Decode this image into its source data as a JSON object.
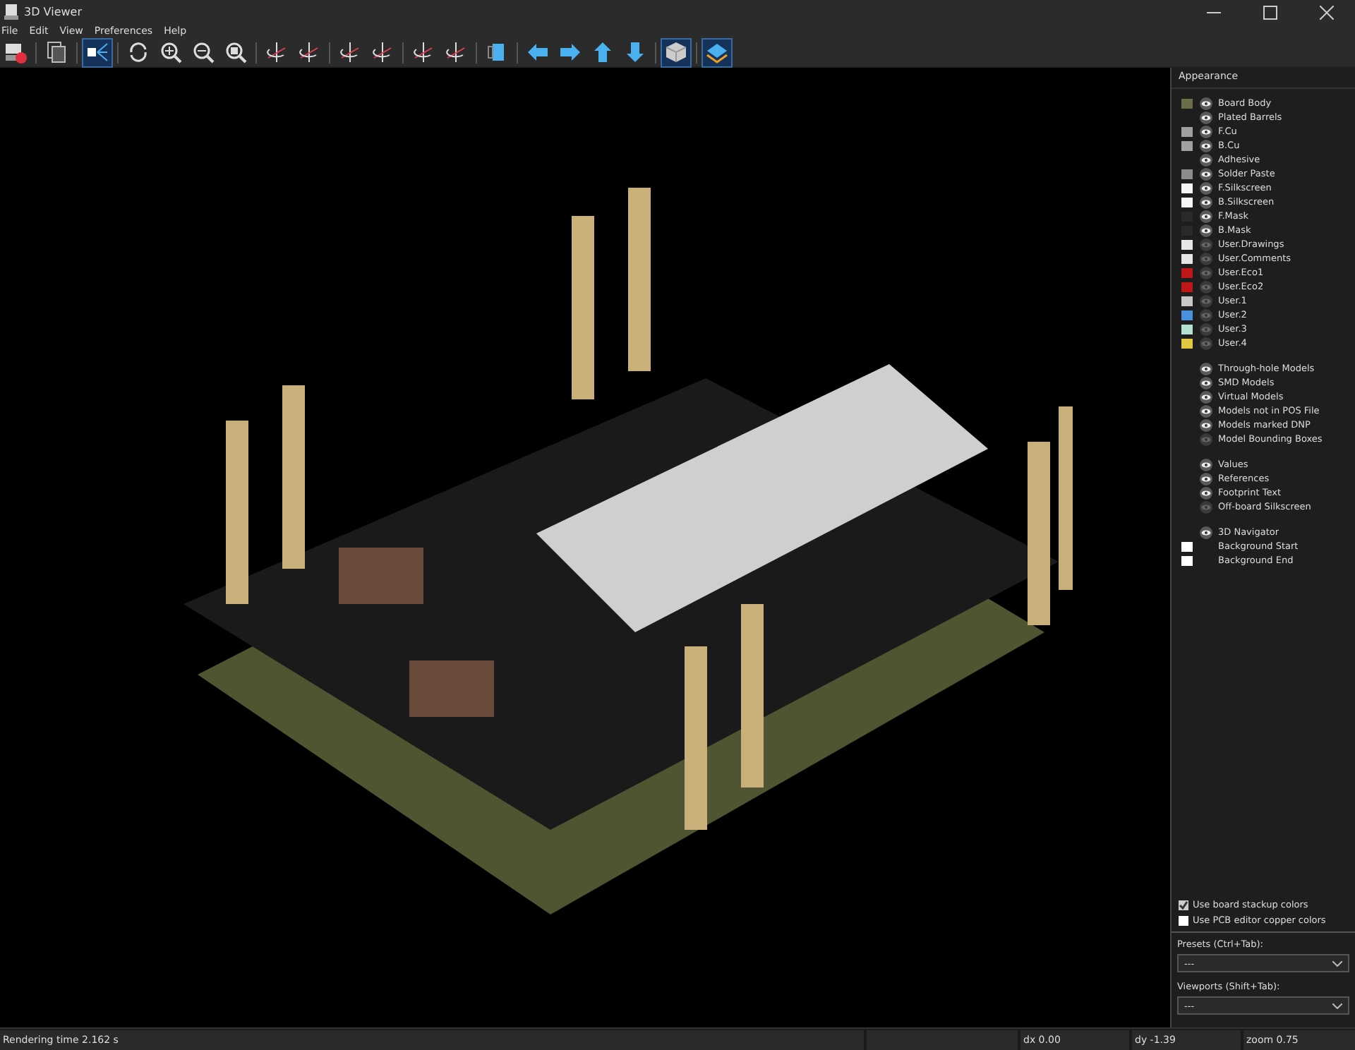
{
  "window": {
    "title": "3D Viewer"
  },
  "menu": [
    "File",
    "Edit",
    "View",
    "Preferences",
    "Help"
  ],
  "toolbar": [
    [
      {
        "kind": "export",
        "on": false
      }
    ],
    [
      {
        "kind": "copy",
        "on": false
      }
    ],
    [
      {
        "kind": "raytrace",
        "on": true
      }
    ],
    [
      {
        "kind": "refresh",
        "on": false
      },
      {
        "kind": "zoom-in",
        "on": false
      },
      {
        "kind": "zoom-out",
        "on": false
      },
      {
        "kind": "zoom-fit",
        "on": false
      }
    ],
    [
      {
        "kind": "rotate",
        "on": false
      },
      {
        "kind": "rotate",
        "on": false
      }
    ],
    [
      {
        "kind": "rotate",
        "on": false
      },
      {
        "kind": "rotate",
        "on": false
      }
    ],
    [
      {
        "kind": "rotate",
        "on": false
      },
      {
        "kind": "rotate",
        "on": false
      }
    ],
    [
      {
        "kind": "flip",
        "on": false
      }
    ],
    [
      {
        "kind": "arrow-left",
        "on": false
      },
      {
        "kind": "arrow-right",
        "on": false
      },
      {
        "kind": "arrow-up",
        "on": false
      },
      {
        "kind": "arrow-down",
        "on": false
      }
    ],
    [
      {
        "kind": "cube",
        "on": true
      }
    ],
    [
      {
        "kind": "layers",
        "on": true
      }
    ]
  ],
  "appearance": {
    "title": "Appearance",
    "groups": [
      [
        {
          "label": "Board Body",
          "color": "#6b6e48",
          "visible": true
        },
        {
          "label": "Plated Barrels",
          "visible": true
        },
        {
          "label": "F.Cu",
          "color": "#a0a0a0",
          "visible": true
        },
        {
          "label": "B.Cu",
          "color": "#a0a0a0",
          "visible": true
        },
        {
          "label": "Adhesive",
          "visible": true
        },
        {
          "label": "Solder Paste",
          "color": "#8c8c8c",
          "visible": true
        },
        {
          "label": "F.Silkscreen",
          "color": "#f5f5f5",
          "visible": true
        },
        {
          "label": "B.Silkscreen",
          "color": "#f5f5f5",
          "visible": true
        },
        {
          "label": "F.Mask",
          "color": "#2a2a2a",
          "visible": true
        },
        {
          "label": "B.Mask",
          "color": "#2a2a2a",
          "visible": true
        },
        {
          "label": "User.Drawings",
          "color": "#e6e6e6",
          "visible": false
        },
        {
          "label": "User.Comments",
          "color": "#e6e6e6",
          "visible": false
        },
        {
          "label": "User.Eco1",
          "color": "#c01818",
          "visible": false
        },
        {
          "label": "User.Eco2",
          "color": "#c01818",
          "visible": false
        },
        {
          "label": "User.1",
          "color": "#c8c8c8",
          "visible": false
        },
        {
          "label": "User.2",
          "color": "#4a8fdc",
          "visible": false
        },
        {
          "label": "User.3",
          "color": "#b4e0d4",
          "visible": false
        },
        {
          "label": "User.4",
          "color": "#e0c840",
          "visible": false
        }
      ],
      [
        {
          "label": "Through-hole Models",
          "visible": true
        },
        {
          "label": "SMD Models",
          "visible": true
        },
        {
          "label": "Virtual Models",
          "visible": true
        },
        {
          "label": "Models not in POS File",
          "visible": true
        },
        {
          "label": "Models marked DNP",
          "visible": true
        },
        {
          "label": "Model Bounding Boxes",
          "visible": false
        }
      ],
      [
        {
          "label": "Values",
          "visible": true
        },
        {
          "label": "References",
          "visible": true
        },
        {
          "label": "Footprint Text",
          "visible": true
        },
        {
          "label": "Off-board Silkscreen",
          "visible": false
        }
      ],
      [
        {
          "label": "3D Navigator",
          "visible": true
        },
        {
          "label": "Background Start",
          "color": "#ffffff"
        },
        {
          "label": "Background End",
          "color": "#ffffff"
        }
      ]
    ],
    "options": [
      {
        "label": "Use board stackup colors",
        "checked": true
      },
      {
        "label": "Use PCB editor copper colors",
        "checked": false
      }
    ],
    "presets": {
      "label": "Presets (Ctrl+Tab):",
      "value": "---"
    },
    "viewports": {
      "label": "Viewports (Shift+Tab):",
      "value": "---"
    }
  },
  "status_bar": [
    "Rendering time 2.162 s",
    "dx 0.00",
    "dy -1.39",
    "zoom 0.75"
  ]
}
